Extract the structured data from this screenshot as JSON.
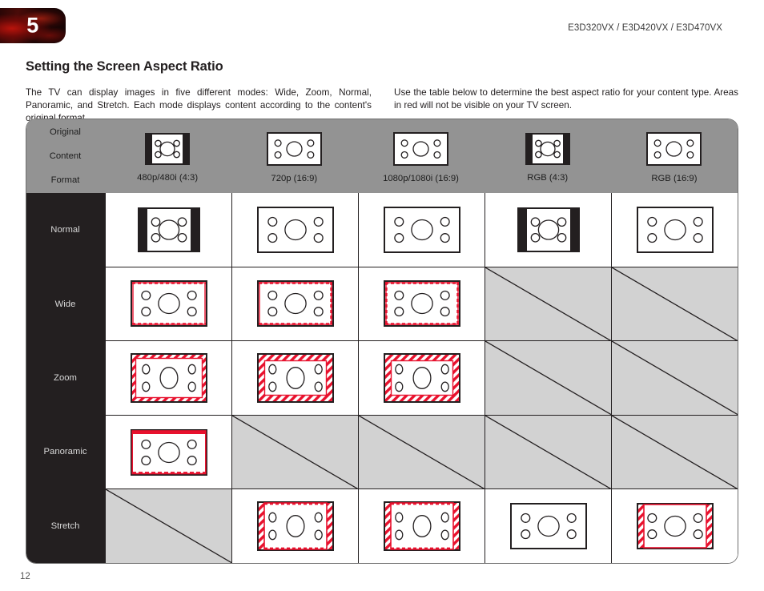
{
  "header": {
    "chapter_number": "5",
    "model_line": "E3D320VX / E3D420VX / E3D470VX"
  },
  "page_title": "Setting the Screen Aspect Ratio",
  "intro": {
    "left": "The TV can display images in five different modes: Wide, Zoom, Normal, Panoramic, and Stretch. Each mode displays content according to the content's original format.",
    "right": "Use the table below to determine the best aspect ratio for your content type. Areas in red will not be visible on your TV screen."
  },
  "table": {
    "corner_label": "Original\nContent\nFormat",
    "corner_lines": [
      "Original",
      "Content",
      "Format"
    ],
    "columns": [
      {
        "label": "480p/480i (4:3)",
        "ratio": "4:3"
      },
      {
        "label": "720p (16:9)",
        "ratio": "16:9"
      },
      {
        "label": "1080p/1080i (16:9)",
        "ratio": "16:9"
      },
      {
        "label": "RGB (4:3)",
        "ratio": "4:3"
      },
      {
        "label": "RGB (16:9)",
        "ratio": "16:9"
      }
    ],
    "rows": [
      {
        "label": "Normal",
        "cells": [
          {
            "available": true,
            "shape": "pillarbox",
            "overlay": "none"
          },
          {
            "available": true,
            "shape": "wide",
            "overlay": "none"
          },
          {
            "available": true,
            "shape": "wide",
            "overlay": "none"
          },
          {
            "available": true,
            "shape": "pillarbox",
            "overlay": "none"
          },
          {
            "available": true,
            "shape": "wide",
            "overlay": "none"
          }
        ]
      },
      {
        "label": "Wide",
        "cells": [
          {
            "available": true,
            "shape": "wide",
            "overlay": "edge-dashed-topbottom"
          },
          {
            "available": true,
            "shape": "wide",
            "overlay": "edge-dashed-topbottom-right"
          },
          {
            "available": true,
            "shape": "wide",
            "overlay": "edge-dashed-all"
          },
          {
            "available": false
          },
          {
            "available": false
          }
        ]
      },
      {
        "label": "Zoom",
        "cells": [
          {
            "available": true,
            "shape": "wide-stretched",
            "overlay": "hatch-border-thin"
          },
          {
            "available": true,
            "shape": "wide-stretched",
            "overlay": "hatch-border-thick"
          },
          {
            "available": true,
            "shape": "wide-stretched",
            "overlay": "hatch-border-thick"
          },
          {
            "available": false
          },
          {
            "available": false
          }
        ]
      },
      {
        "label": "Panoramic",
        "cells": [
          {
            "available": true,
            "shape": "wide",
            "overlay": "bar-top-solid-bottom-dashed"
          },
          {
            "available": false
          },
          {
            "available": false
          },
          {
            "available": false
          },
          {
            "available": false
          }
        ]
      },
      {
        "label": "Stretch",
        "cells": [
          {
            "available": false
          },
          {
            "available": true,
            "shape": "wide-stretched",
            "overlay": "hatch-sides-dashed-topbottom"
          },
          {
            "available": true,
            "shape": "wide-stretched",
            "overlay": "hatch-sides-dashed-topbottom"
          },
          {
            "available": true,
            "shape": "wide",
            "overlay": "none"
          },
          {
            "available": true,
            "shape": "wide",
            "overlay": "hatch-sides"
          }
        ]
      }
    ]
  },
  "page_number": "12",
  "colors": {
    "crop_red": "#e8112d",
    "header_gray": "#939393",
    "label_dark": "#231f20",
    "na_gray": "#d2d2d2",
    "badge_red": "#500c09"
  }
}
